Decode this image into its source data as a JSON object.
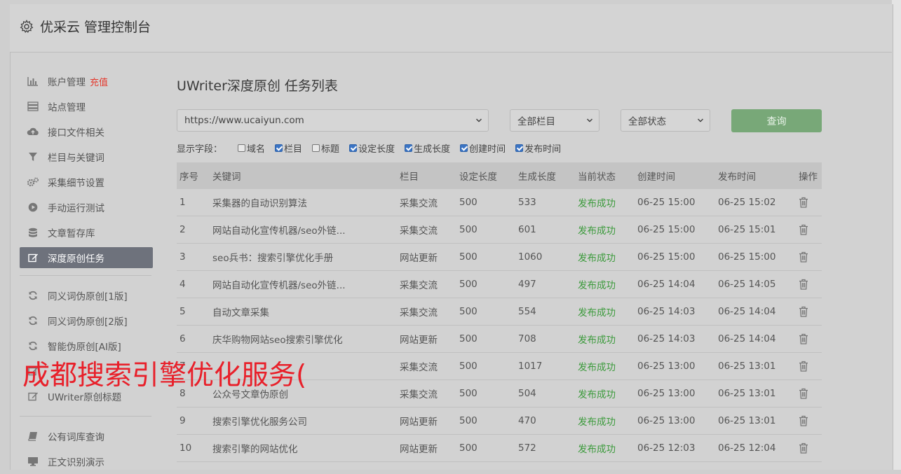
{
  "header": {
    "title": "优采云 管理控制台"
  },
  "sidebar": {
    "group1": [
      {
        "label": "账户管理",
        "icon": "bar-chart-icon",
        "extra": "充值"
      },
      {
        "label": "站点管理",
        "icon": "server-icon"
      },
      {
        "label": "接口文件相关",
        "icon": "cloud-upload-icon"
      },
      {
        "label": "栏目与关键词",
        "icon": "filter-icon"
      },
      {
        "label": "采集细节设置",
        "icon": "gears-icon"
      },
      {
        "label": "手动运行测试",
        "icon": "play-circle-icon"
      },
      {
        "label": "文章暂存库",
        "icon": "database-icon"
      },
      {
        "label": "深度原创任务",
        "icon": "edit-icon",
        "active": true
      }
    ],
    "group2": [
      {
        "label": "同义词伪原创[1版]",
        "icon": "refresh-icon"
      },
      {
        "label": "同义词伪原创[2版]",
        "icon": "refresh-icon"
      },
      {
        "label": "智能伪原创[AI版]",
        "icon": "refresh-icon"
      },
      {
        "label": "",
        "icon": "edit-icon"
      },
      {
        "label": "UWriter原创标题",
        "icon": "edit-icon"
      }
    ],
    "group3": [
      {
        "label": "公有词库查询",
        "icon": "book-icon"
      },
      {
        "label": "正文识别演示",
        "icon": "monitor-icon"
      }
    ]
  },
  "main": {
    "title": "UWriter深度原创 任务列表",
    "site_select": "https://www.ucaiyun.com",
    "column_select": "全部栏目",
    "status_select": "全部状态",
    "query_button": "查询",
    "fields_label": "显示字段：",
    "fields": [
      {
        "label": "域名",
        "checked": false
      },
      {
        "label": "栏目",
        "checked": true
      },
      {
        "label": "标题",
        "checked": false
      },
      {
        "label": "设定长度",
        "checked": true
      },
      {
        "label": "生成长度",
        "checked": true
      },
      {
        "label": "创建时间",
        "checked": true
      },
      {
        "label": "发布时间",
        "checked": true
      }
    ],
    "table": {
      "headers": [
        "序号",
        "关键词",
        "栏目",
        "设定长度",
        "生成长度",
        "当前状态",
        "创建时间",
        "发布时间",
        "操作"
      ],
      "rows": [
        [
          "1",
          "采集器的自动识别算法",
          "采集交流",
          "500",
          "533",
          "发布成功",
          "06-25 15:00",
          "06-25 15:02"
        ],
        [
          "2",
          "网站自动化宣传机器/seo外链...",
          "采集交流",
          "500",
          "601",
          "发布成功",
          "06-25 15:00",
          "06-25 15:01"
        ],
        [
          "3",
          "seo兵书：搜索引擎优化手册",
          "网站更新",
          "500",
          "1060",
          "发布成功",
          "06-25 15:00",
          "06-25 15:00"
        ],
        [
          "4",
          "网站自动化宣传机器/seo外链...",
          "采集交流",
          "500",
          "497",
          "发布成功",
          "06-25 14:04",
          "06-25 14:05"
        ],
        [
          "5",
          "自动文章采集",
          "采集交流",
          "500",
          "554",
          "发布成功",
          "06-25 14:03",
          "06-25 14:04"
        ],
        [
          "6",
          "庆华购物网站seo搜索引擎优化",
          "网站更新",
          "500",
          "708",
          "发布成功",
          "06-25 14:03",
          "06-25 14:04"
        ],
        [
          "7",
          "",
          "采集交流",
          "500",
          "1017",
          "发布成功",
          "06-25 13:00",
          "06-25 13:01"
        ],
        [
          "8",
          "公众号文章伪原创",
          "采集交流",
          "500",
          "504",
          "发布成功",
          "06-25 13:00",
          "06-25 13:01"
        ],
        [
          "9",
          "搜索引擎优化服务公司",
          "网站更新",
          "500",
          "470",
          "发布成功",
          "06-25 13:00",
          "06-25 13:01"
        ],
        [
          "10",
          "搜索引擎的网站优化",
          "网站更新",
          "500",
          "572",
          "发布成功",
          "06-25 12:03",
          "06-25 12:04"
        ]
      ]
    }
  },
  "overlay_text": "成都搜索引擎优化服务(",
  "colors": {
    "success": "#3b9a3b",
    "query_button": "#78a878",
    "active_item": "#6e727c",
    "overlay": "#e8202a",
    "recharge": "#e43a2e"
  }
}
